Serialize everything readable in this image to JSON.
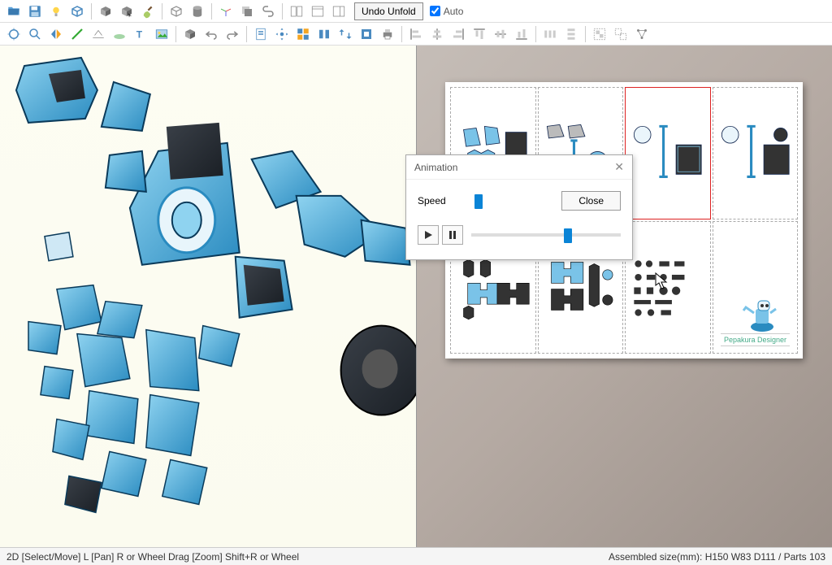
{
  "toolbar": {
    "undo_unfold": "Undo Unfold",
    "auto_label": "Auto",
    "row1_icons": [
      "open-icon",
      "save-icon",
      "light-icon",
      "3d-icon",
      "cube-icon",
      "cube-select-icon",
      "paint-icon",
      "box-icon",
      "cylinder-icon",
      "axes-icon",
      "layers-icon",
      "link-icon",
      "split-view-icon",
      "window-icon",
      "panel-icon"
    ],
    "row2_icons": [
      "recenter-icon",
      "zoom-icon",
      "mirror-icon",
      "edge-icon",
      "flatten-icon",
      "plane-icon",
      "text-icon",
      "image-icon",
      "cube2-icon",
      "undo-icon",
      "redo-icon",
      "page-icon",
      "settings-icon",
      "layout-icon",
      "align-icon",
      "swap-icon",
      "color-icon",
      "print-icon",
      "align-left-icon",
      "align-center-icon",
      "align-right-icon",
      "align-top-icon",
      "align-middle-icon",
      "align-bottom-icon",
      "distribute-h-icon",
      "distribute-v-icon",
      "group-icon",
      "ungroup-icon",
      "nodes-icon"
    ]
  },
  "dialog": {
    "title": "Animation",
    "speed_label": "Speed",
    "close_button": "Close"
  },
  "paper": {
    "logo_text": "Pepakura Designer"
  },
  "statusbar": {
    "left": "2D [Select/Move] L [Pan] R or Wheel Drag [Zoom] Shift+R or Wheel",
    "right": "Assembled size(mm): H150 W83 D111 / Parts 103"
  },
  "colors": {
    "accent": "#0a84d6",
    "robot_blue": "#4ab3e5",
    "robot_dark": "#2a2f38"
  }
}
